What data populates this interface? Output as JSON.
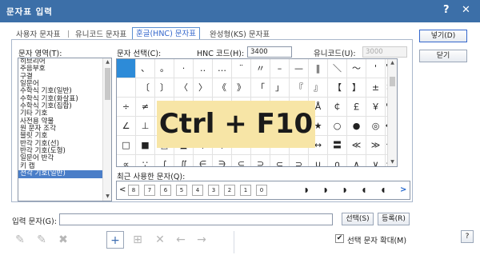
{
  "window": {
    "title": "문자표 입력",
    "help": "?",
    "close": "✕"
  },
  "tabs": [
    {
      "label": "사용자 문자표"
    },
    {
      "label": "유니코드 문자표"
    },
    {
      "label": "훈글(HNC) 문자표"
    },
    {
      "label": "완성형(KS) 문자표"
    }
  ],
  "tab_separator": "|",
  "category": {
    "label": "문자 영역(T):",
    "items": [
      "히브리어",
      "주음부호",
      "구결",
      "일문어",
      "수학식 기호(일반)",
      "수학식 기호(화살표)",
      "수학식 기호(집합)",
      "기타 기호",
      "사전용 약물",
      "원 문자 조각",
      "블릿 기호",
      "반각 기호(선)",
      "반각 기호(도형)",
      "일문어 반각",
      "키 캡",
      "전각 기호(일반)"
    ],
    "selected": "전각 기호(일반)"
  },
  "char_select": {
    "label": "문자 선택(C):"
  },
  "hnc_code": {
    "label": "HNC 코드(H):",
    "value": "3400"
  },
  "unicode": {
    "label": "유니코드(U):",
    "value": "3000"
  },
  "grid_chars": [
    [
      "",
      "、",
      "。",
      "·",
      "‥",
      "…",
      "¨",
      "〃",
      "–",
      "—",
      "‖",
      "＼",
      "～",
      "'"
    ],
    [
      "",
      "〔",
      "〕",
      "〈",
      "〉",
      "《",
      "》",
      "「",
      "」",
      "『",
      "』",
      "【",
      "】",
      "±"
    ],
    [
      "÷",
      "≠",
      "≤",
      "≥",
      "∞",
      "∴",
      "°",
      "′",
      "″",
      "℃",
      "Å",
      "￠",
      "￡",
      "￥"
    ],
    [
      "∠",
      "⊥",
      "⌒",
      "∂",
      "∇",
      "≡",
      "≒",
      "§",
      "※",
      "☆",
      "★",
      "○",
      "●",
      "◎"
    ],
    [
      "□",
      "■",
      "△",
      "▲",
      "▽",
      "▼",
      "→",
      "←",
      "↑",
      "↓",
      "↔",
      "〓",
      "≪",
      "≫"
    ],
    [
      "∝",
      "∵",
      "∫",
      "∬",
      "∈",
      "∋",
      "⊆",
      "⊇",
      "⊂",
      "⊃",
      "∪",
      "∩",
      "∧",
      "∨"
    ]
  ],
  "grid_extra_col": [
    "'",
    "×",
    "♀",
    "◆",
    "∽",
    "¬"
  ],
  "hint_overlay": "Ctrl + F10",
  "recent": {
    "label": "최근 사용한 문자(Q):",
    "keys": [
      "8",
      "7",
      "6",
      "5",
      "4",
      "3",
      "2",
      "1",
      "0"
    ],
    "prev": "<",
    "next": ">"
  },
  "input": {
    "label": "입력 문자(G):",
    "value": ""
  },
  "buttons": {
    "insert": "넣기(D)",
    "close": "닫기",
    "select": "선택(S)",
    "register": "등록(R)",
    "help": "?"
  },
  "toolbar": {
    "add": "+",
    "delete": "✕",
    "left": "←",
    "right": "→"
  },
  "zoom_check": {
    "label": "선택 문자 확대(M)",
    "checked": true
  }
}
